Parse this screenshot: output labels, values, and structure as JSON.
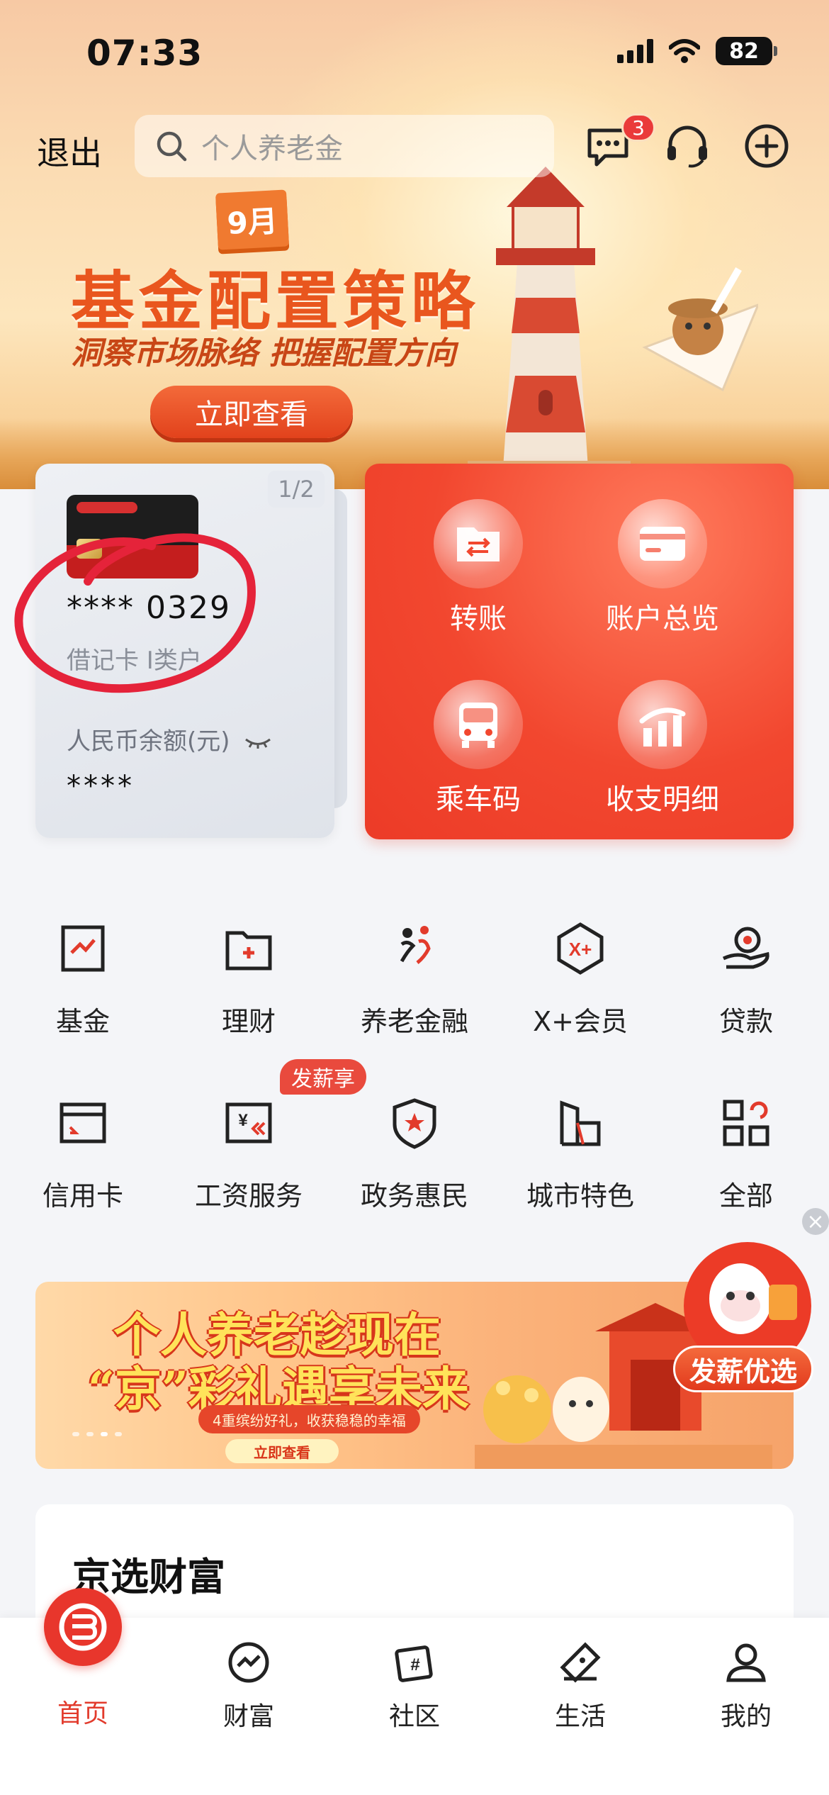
{
  "status_bar": {
    "time": "07:33",
    "battery": "82"
  },
  "top_bar": {
    "exit_label": "退出",
    "search_placeholder": "个人养老金",
    "message_badge": "3"
  },
  "hero_banner": {
    "month": "9月",
    "title": "基金配置策略",
    "subtitle": "洞察市场脉络 把握配置方向",
    "button": "立即查看"
  },
  "account_card": {
    "page_indicator": "1/2",
    "card_number": "**** 0329",
    "card_type": "借记卡 I类户",
    "balance_label": "人民币余额(元)",
    "balance_value": "****"
  },
  "quick_actions": [
    {
      "label": "转账",
      "icon": "transfer-icon"
    },
    {
      "label": "账户总览",
      "icon": "card-icon"
    },
    {
      "label": "乘车码",
      "icon": "bus-icon"
    },
    {
      "label": "收支明细",
      "icon": "bar-chart-icon"
    }
  ],
  "services": [
    {
      "label": "基金",
      "icon": "fund-icon"
    },
    {
      "label": "理财",
      "icon": "wealth-folder-icon"
    },
    {
      "label": "养老金融",
      "icon": "pension-icon"
    },
    {
      "label": "X+会员",
      "icon": "member-icon"
    },
    {
      "label": "贷款",
      "icon": "loan-icon"
    },
    {
      "label": "信用卡",
      "icon": "credit-card-icon"
    },
    {
      "label": "工资服务",
      "icon": "salary-icon"
    },
    {
      "label": "政务惠民",
      "icon": "government-icon"
    },
    {
      "label": "城市特色",
      "icon": "city-icon"
    },
    {
      "label": "全部",
      "icon": "all-apps-icon"
    }
  ],
  "service_tag": "发薪享",
  "promo": {
    "line1": "个人养老趁现在",
    "line2": "“京”彩礼遇享未来",
    "sub": "4重缤纷好礼，收获稳稳的幸福",
    "button": "立即查看",
    "float_label": "发薪优选"
  },
  "section": {
    "title": "京选财富"
  },
  "tabbar": [
    {
      "label": "首页",
      "icon": "home-logo-icon",
      "active": true
    },
    {
      "label": "财富",
      "icon": "wealth-chart-icon"
    },
    {
      "label": "社区",
      "icon": "community-icon"
    },
    {
      "label": "生活",
      "icon": "life-ticket-icon"
    },
    {
      "label": "我的",
      "icon": "profile-icon"
    }
  ],
  "colors": {
    "accent": "#e23b2c",
    "panel": "#f2472f",
    "hero_title": "#e9561e"
  }
}
